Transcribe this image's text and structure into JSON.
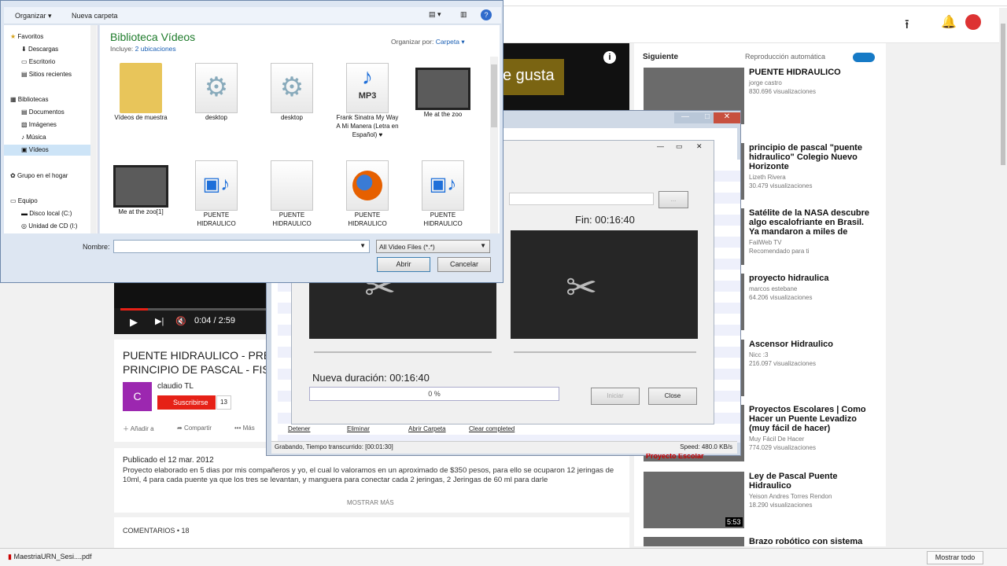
{
  "youtube": {
    "video_overlay_text": "e gusta",
    "time": "0:04 / 2:59",
    "title_line1": "PUENTE HIDRAULICO - PRE",
    "title_line2": "PRINCIPIO DE PASCAL - FIS",
    "channel": "claudio TL",
    "channel_initial": "C",
    "subscribe_label": "Suscribirse",
    "subscriber_count": "13",
    "add_label": "Añadir a",
    "share_label": "Compartir",
    "more_label": "Más",
    "published": "Publicado el 12 mar. 2012",
    "description": "Proyecto elaborado en 5 dias por mis compañeros y yo, el cual lo valoramos en un aproximado de $350 pesos, para ello se ocuparon 12 jeringas de 10ml, 4 para cada puente ya que los tres se levantan, y manguera para conectar cada 2 jeringas, 2 Jeringas de 60 ml para darle",
    "show_more": "MOSTRAR MÁS",
    "comments": "COMENTARIOS • 18",
    "next_label": "Siguiente",
    "autoplay_label": "Reproducción automática",
    "sidebar": [
      {
        "title": "PUENTE HIDRAULICO",
        "channel": "jorge castro",
        "views": "830.696 visualizaciones"
      },
      {
        "title": "principio de pascal \"puente hidraulico\" Colegio Nuevo Horizonte",
        "channel": "Lizeth Rivera",
        "views": "30.479 visualizaciones"
      },
      {
        "title": "Satélite de la NASA descubre algo escalofriante en Brasil. Ya mandaron a miles de",
        "channel": "FailWeb TV",
        "views": "Recomendado para ti"
      },
      {
        "title": "proyecto hidraulica",
        "channel": "marcos estebane",
        "views": "64.206 visualizaciones"
      },
      {
        "title": "Ascensor Hidraulico",
        "channel": "Nicc :3",
        "views": "216.097 visualizaciones"
      },
      {
        "title": "Proyectos Escolares | Como Hacer un Puente Levadizo (muy fácil de hacer)",
        "channel": "Muy Fácil De Hacer",
        "views": "774.029 visualizaciones"
      },
      {
        "title": "Ley de Pascal Puente Hidraulico",
        "channel": "Yeison Andres Torres Rendon",
        "views": "18.290 visualizaciones",
        "duration": "5:53"
      },
      {
        "title": "Brazo robótico con sistema",
        "channel": "",
        "views": ""
      }
    ],
    "download_file": "MaestriaURN_Sesi....pdf",
    "show_all": "Mostrar todo"
  },
  "recorder": {
    "status_left": "Grabando, Tiempo transcurrido: [00:01:30]",
    "status_right": "Speed: 480.0 KB/s",
    "links": [
      "Detener",
      "Eliminar",
      "Abrir Carpeta",
      "Clear completed"
    ],
    "behind_text": "Proyecto Escolar"
  },
  "cutter": {
    "end_label": "Fin: 00:16:40",
    "duration_label": "Nueva duración: 00:16:40",
    "progress": "0 %",
    "progress_value": 0,
    "start_button": "Iniciar",
    "close_button": "Close",
    "browse_button": "..."
  },
  "file_dialog": {
    "organize": "Organizar",
    "new_folder": "Nueva carpeta",
    "library_title": "Biblioteca Vídeos",
    "includes_label": "Incluye:",
    "includes_link": "2 ubicaciones",
    "arrange_label": "Organizar por:",
    "arrange_value": "Carpeta",
    "nav": [
      {
        "label": "Favoritos",
        "level": 0
      },
      {
        "label": "Descargas",
        "level": 1
      },
      {
        "label": "Escritorio",
        "level": 1
      },
      {
        "label": "Sitios recientes",
        "level": 1
      },
      {
        "label": "Bibliotecas",
        "level": 0
      },
      {
        "label": "Documentos",
        "level": 1
      },
      {
        "label": "Imágenes",
        "level": 1
      },
      {
        "label": "Música",
        "level": 1
      },
      {
        "label": "Vídeos",
        "level": 1
      },
      {
        "label": "Grupo en el hogar",
        "level": 0
      },
      {
        "label": "Equipo",
        "level": 0
      },
      {
        "label": "Disco local (C:)",
        "level": 1
      },
      {
        "label": "Unidad de CD (I:)",
        "level": 1
      }
    ],
    "files": [
      {
        "name": "Vídeos de muestra",
        "icon": "folder-icon"
      },
      {
        "name": "desktop",
        "icon": "settings-file-icon"
      },
      {
        "name": "desktop",
        "icon": "settings-file-icon"
      },
      {
        "name": "Frank Sinatra My Way   A Mi Manera (Letra en Español) ♥",
        "icon": "mp3-file-icon"
      },
      {
        "name": "Me at the zoo",
        "icon": "video-thumbnail-icon"
      },
      {
        "name": "Me at the zoo[1]",
        "icon": "video-thumbnail-icon"
      },
      {
        "name": "PUENTE HIDRAULICO",
        "icon": "video-file-icon"
      },
      {
        "name": "PUENTE HIDRAULICO",
        "icon": "blank-file-icon"
      },
      {
        "name": "PUENTE HIDRAULICO",
        "icon": "firefox-file-icon"
      },
      {
        "name": "PUENTE HIDRAULICO",
        "icon": "video-file-icon"
      }
    ],
    "mp3_label": "MP3",
    "filename_label": "Nombre:",
    "filename_value": "",
    "filter_value": "All Video Files (*.*)",
    "open_button": "Abrir",
    "cancel_button": "Cancelar"
  },
  "colors": {
    "youtube_red": "#e62117",
    "library_green": "#1e7b2b",
    "link_blue": "#1a5fb4"
  }
}
